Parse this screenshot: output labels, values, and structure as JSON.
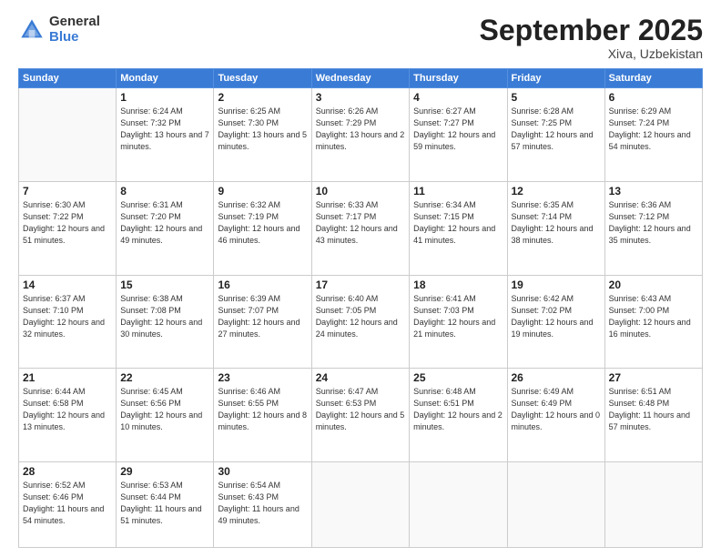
{
  "logo": {
    "general": "General",
    "blue": "Blue"
  },
  "header": {
    "month": "September 2025",
    "location": "Xiva, Uzbekistan"
  },
  "days_of_week": [
    "Sunday",
    "Monday",
    "Tuesday",
    "Wednesday",
    "Thursday",
    "Friday",
    "Saturday"
  ],
  "weeks": [
    [
      {
        "day": "",
        "sunrise": "",
        "sunset": "",
        "daylight": ""
      },
      {
        "day": "1",
        "sunrise": "Sunrise: 6:24 AM",
        "sunset": "Sunset: 7:32 PM",
        "daylight": "Daylight: 13 hours and 7 minutes."
      },
      {
        "day": "2",
        "sunrise": "Sunrise: 6:25 AM",
        "sunset": "Sunset: 7:30 PM",
        "daylight": "Daylight: 13 hours and 5 minutes."
      },
      {
        "day": "3",
        "sunrise": "Sunrise: 6:26 AM",
        "sunset": "Sunset: 7:29 PM",
        "daylight": "Daylight: 13 hours and 2 minutes."
      },
      {
        "day": "4",
        "sunrise": "Sunrise: 6:27 AM",
        "sunset": "Sunset: 7:27 PM",
        "daylight": "Daylight: 12 hours and 59 minutes."
      },
      {
        "day": "5",
        "sunrise": "Sunrise: 6:28 AM",
        "sunset": "Sunset: 7:25 PM",
        "daylight": "Daylight: 12 hours and 57 minutes."
      },
      {
        "day": "6",
        "sunrise": "Sunrise: 6:29 AM",
        "sunset": "Sunset: 7:24 PM",
        "daylight": "Daylight: 12 hours and 54 minutes."
      }
    ],
    [
      {
        "day": "7",
        "sunrise": "Sunrise: 6:30 AM",
        "sunset": "Sunset: 7:22 PM",
        "daylight": "Daylight: 12 hours and 51 minutes."
      },
      {
        "day": "8",
        "sunrise": "Sunrise: 6:31 AM",
        "sunset": "Sunset: 7:20 PM",
        "daylight": "Daylight: 12 hours and 49 minutes."
      },
      {
        "day": "9",
        "sunrise": "Sunrise: 6:32 AM",
        "sunset": "Sunset: 7:19 PM",
        "daylight": "Daylight: 12 hours and 46 minutes."
      },
      {
        "day": "10",
        "sunrise": "Sunrise: 6:33 AM",
        "sunset": "Sunset: 7:17 PM",
        "daylight": "Daylight: 12 hours and 43 minutes."
      },
      {
        "day": "11",
        "sunrise": "Sunrise: 6:34 AM",
        "sunset": "Sunset: 7:15 PM",
        "daylight": "Daylight: 12 hours and 41 minutes."
      },
      {
        "day": "12",
        "sunrise": "Sunrise: 6:35 AM",
        "sunset": "Sunset: 7:14 PM",
        "daylight": "Daylight: 12 hours and 38 minutes."
      },
      {
        "day": "13",
        "sunrise": "Sunrise: 6:36 AM",
        "sunset": "Sunset: 7:12 PM",
        "daylight": "Daylight: 12 hours and 35 minutes."
      }
    ],
    [
      {
        "day": "14",
        "sunrise": "Sunrise: 6:37 AM",
        "sunset": "Sunset: 7:10 PM",
        "daylight": "Daylight: 12 hours and 32 minutes."
      },
      {
        "day": "15",
        "sunrise": "Sunrise: 6:38 AM",
        "sunset": "Sunset: 7:08 PM",
        "daylight": "Daylight: 12 hours and 30 minutes."
      },
      {
        "day": "16",
        "sunrise": "Sunrise: 6:39 AM",
        "sunset": "Sunset: 7:07 PM",
        "daylight": "Daylight: 12 hours and 27 minutes."
      },
      {
        "day": "17",
        "sunrise": "Sunrise: 6:40 AM",
        "sunset": "Sunset: 7:05 PM",
        "daylight": "Daylight: 12 hours and 24 minutes."
      },
      {
        "day": "18",
        "sunrise": "Sunrise: 6:41 AM",
        "sunset": "Sunset: 7:03 PM",
        "daylight": "Daylight: 12 hours and 21 minutes."
      },
      {
        "day": "19",
        "sunrise": "Sunrise: 6:42 AM",
        "sunset": "Sunset: 7:02 PM",
        "daylight": "Daylight: 12 hours and 19 minutes."
      },
      {
        "day": "20",
        "sunrise": "Sunrise: 6:43 AM",
        "sunset": "Sunset: 7:00 PM",
        "daylight": "Daylight: 12 hours and 16 minutes."
      }
    ],
    [
      {
        "day": "21",
        "sunrise": "Sunrise: 6:44 AM",
        "sunset": "Sunset: 6:58 PM",
        "daylight": "Daylight: 12 hours and 13 minutes."
      },
      {
        "day": "22",
        "sunrise": "Sunrise: 6:45 AM",
        "sunset": "Sunset: 6:56 PM",
        "daylight": "Daylight: 12 hours and 10 minutes."
      },
      {
        "day": "23",
        "sunrise": "Sunrise: 6:46 AM",
        "sunset": "Sunset: 6:55 PM",
        "daylight": "Daylight: 12 hours and 8 minutes."
      },
      {
        "day": "24",
        "sunrise": "Sunrise: 6:47 AM",
        "sunset": "Sunset: 6:53 PM",
        "daylight": "Daylight: 12 hours and 5 minutes."
      },
      {
        "day": "25",
        "sunrise": "Sunrise: 6:48 AM",
        "sunset": "Sunset: 6:51 PM",
        "daylight": "Daylight: 12 hours and 2 minutes."
      },
      {
        "day": "26",
        "sunrise": "Sunrise: 6:49 AM",
        "sunset": "Sunset: 6:49 PM",
        "daylight": "Daylight: 12 hours and 0 minutes."
      },
      {
        "day": "27",
        "sunrise": "Sunrise: 6:51 AM",
        "sunset": "Sunset: 6:48 PM",
        "daylight": "Daylight: 11 hours and 57 minutes."
      }
    ],
    [
      {
        "day": "28",
        "sunrise": "Sunrise: 6:52 AM",
        "sunset": "Sunset: 6:46 PM",
        "daylight": "Daylight: 11 hours and 54 minutes."
      },
      {
        "day": "29",
        "sunrise": "Sunrise: 6:53 AM",
        "sunset": "Sunset: 6:44 PM",
        "daylight": "Daylight: 11 hours and 51 minutes."
      },
      {
        "day": "30",
        "sunrise": "Sunrise: 6:54 AM",
        "sunset": "Sunset: 6:43 PM",
        "daylight": "Daylight: 11 hours and 49 minutes."
      },
      {
        "day": "",
        "sunrise": "",
        "sunset": "",
        "daylight": ""
      },
      {
        "day": "",
        "sunrise": "",
        "sunset": "",
        "daylight": ""
      },
      {
        "day": "",
        "sunrise": "",
        "sunset": "",
        "daylight": ""
      },
      {
        "day": "",
        "sunrise": "",
        "sunset": "",
        "daylight": ""
      }
    ]
  ]
}
